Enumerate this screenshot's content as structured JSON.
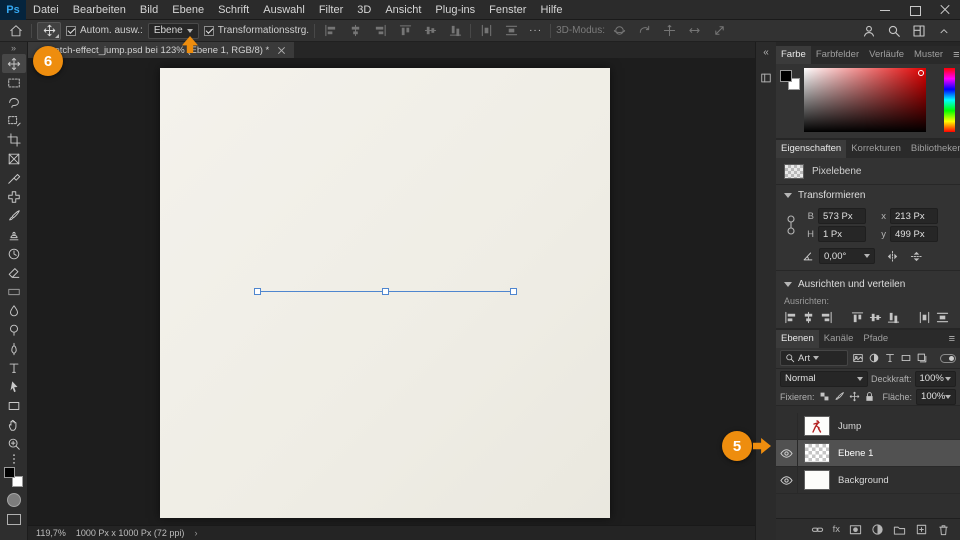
{
  "app": {
    "logo_text": "Ps"
  },
  "menubar": {
    "items": [
      "Datei",
      "Bearbeiten",
      "Bild",
      "Ebene",
      "Schrift",
      "Auswahl",
      "Filter",
      "3D",
      "Ansicht",
      "Plug-ins",
      "Fenster",
      "Hilfe"
    ]
  },
  "optionsbar": {
    "auto_select_label": "Autom. ausw.:",
    "auto_select_value": "Ebene",
    "transform_controls_label": "Transformationsstrg.",
    "more_icon": "···",
    "mode3d_label": "3D-Modus:"
  },
  "document_tab": {
    "title": "...stretch-effect_jump.psd bei 123% (Ebene 1, RGB/8) *"
  },
  "statusbar": {
    "zoom": "119,7%",
    "doc_info": "1000 Px x 1000 Px (72 ppi)",
    "chevron": "›"
  },
  "color_panel": {
    "tabs": [
      "Farbe",
      "Farbfelder",
      "Verläufe",
      "Muster"
    ],
    "active_tab": "Farbe"
  },
  "properties_panel": {
    "tabs": [
      "Eigenschaften",
      "Korrekturen",
      "Bibliotheken"
    ],
    "active_tab": "Eigenschaften",
    "layer_type_label": "Pixelebene",
    "transform_section_title": "Transformieren",
    "width_label": "B",
    "width_value": "573 Px",
    "x_label": "x",
    "x_value": "213 Px",
    "height_label": "H",
    "height_value": "1 Px",
    "y_label": "y",
    "y_value": "499 Px",
    "angle_value": "0,00°",
    "align_section_title": "Ausrichten und verteilen",
    "align_label": "Ausrichten:"
  },
  "layers_panel": {
    "tabs": [
      "Ebenen",
      "Kanäle",
      "Pfade"
    ],
    "active_tab": "Ebenen",
    "filter_type_value": "Art",
    "blend_mode_value": "Normal",
    "opacity_label": "Deckkraft:",
    "opacity_value": "100%",
    "lock_label": "Fixieren:",
    "fill_label": "Fläche:",
    "fill_value": "100%",
    "fx_label": "fx",
    "layers": [
      {
        "name": "Jump",
        "visible": false,
        "selected": false
      },
      {
        "name": "Ebene 1",
        "visible": true,
        "selected": true
      },
      {
        "name": "Background",
        "visible": true,
        "selected": false
      }
    ]
  },
  "annotations": {
    "step_5": "5",
    "step_6": "6"
  },
  "colors": {
    "annotation_orange": "#ee8d0e",
    "selection_blue": "#4f86cf",
    "canvas_paper": "#f1efe8"
  }
}
